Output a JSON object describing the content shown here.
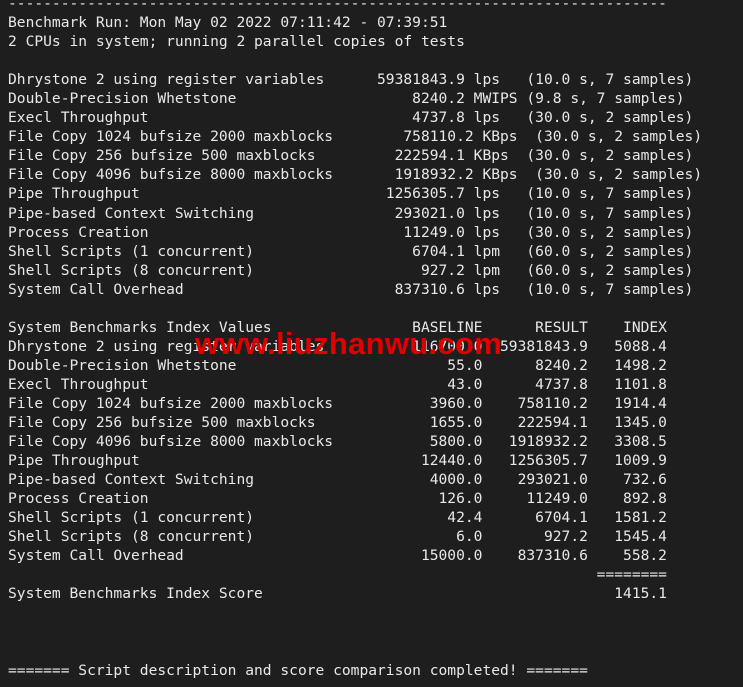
{
  "separator_top": "---------------------------------------------------------------------------",
  "header": {
    "run_line": "Benchmark Run: Mon May 02 2022 07:11:42 - 07:39:51",
    "cpu_line": "2 CPUs in system; running 2 parallel copies of tests"
  },
  "results": [
    {
      "name": "Dhrystone 2 using register variables",
      "value": "59381843.9",
      "unit": "lps",
      "info": "(10.0 s, 7 samples)"
    },
    {
      "name": "Double-Precision Whetstone",
      "value": "8240.2",
      "unit": "MWIPS",
      "info": "(9.8 s, 7 samples)"
    },
    {
      "name": "Execl Throughput",
      "value": "4737.8",
      "unit": "lps",
      "info": "(30.0 s, 2 samples)"
    },
    {
      "name": "File Copy 1024 bufsize 2000 maxblocks",
      "value": "758110.2",
      "unit": "KBps",
      "info": "(30.0 s, 2 samples)"
    },
    {
      "name": "File Copy 256 bufsize 500 maxblocks",
      "value": "222594.1",
      "unit": "KBps",
      "info": "(30.0 s, 2 samples)"
    },
    {
      "name": "File Copy 4096 bufsize 8000 maxblocks",
      "value": "1918932.2",
      "unit": "KBps",
      "info": "(30.0 s, 2 samples)"
    },
    {
      "name": "Pipe Throughput",
      "value": "1256305.7",
      "unit": "lps",
      "info": "(10.0 s, 7 samples)"
    },
    {
      "name": "Pipe-based Context Switching",
      "value": "293021.0",
      "unit": "lps",
      "info": "(10.0 s, 7 samples)"
    },
    {
      "name": "Process Creation",
      "value": "11249.0",
      "unit": "lps",
      "info": "(30.0 s, 2 samples)"
    },
    {
      "name": "Shell Scripts (1 concurrent)",
      "value": "6704.1",
      "unit": "lpm",
      "info": "(60.0 s, 2 samples)"
    },
    {
      "name": "Shell Scripts (8 concurrent)",
      "value": "927.2",
      "unit": "lpm",
      "info": "(60.0 s, 2 samples)"
    },
    {
      "name": "System Call Overhead",
      "value": "837310.6",
      "unit": "lps",
      "info": "(10.0 s, 7 samples)"
    }
  ],
  "index_table": {
    "title": "System Benchmarks Index Values",
    "headers": [
      "BASELINE",
      "RESULT",
      "INDEX"
    ],
    "rows": [
      {
        "name": "Dhrystone 2 using register variables",
        "baseline": "116700.0",
        "result": "59381843.9",
        "index": "5088.4"
      },
      {
        "name": "Double-Precision Whetstone",
        "baseline": "55.0",
        "result": "8240.2",
        "index": "1498.2"
      },
      {
        "name": "Execl Throughput",
        "baseline": "43.0",
        "result": "4737.8",
        "index": "1101.8"
      },
      {
        "name": "File Copy 1024 bufsize 2000 maxblocks",
        "baseline": "3960.0",
        "result": "758110.2",
        "index": "1914.4"
      },
      {
        "name": "File Copy 256 bufsize 500 maxblocks",
        "baseline": "1655.0",
        "result": "222594.1",
        "index": "1345.0"
      },
      {
        "name": "File Copy 4096 bufsize 8000 maxblocks",
        "baseline": "5800.0",
        "result": "1918932.2",
        "index": "3308.5"
      },
      {
        "name": "Pipe Throughput",
        "baseline": "12440.0",
        "result": "1256305.7",
        "index": "1009.9"
      },
      {
        "name": "Pipe-based Context Switching",
        "baseline": "4000.0",
        "result": "293021.0",
        "index": "732.6"
      },
      {
        "name": "Process Creation",
        "baseline": "126.0",
        "result": "11249.0",
        "index": "892.8"
      },
      {
        "name": "Shell Scripts (1 concurrent)",
        "baseline": "42.4",
        "result": "6704.1",
        "index": "1581.2"
      },
      {
        "name": "Shell Scripts (8 concurrent)",
        "baseline": "6.0",
        "result": "927.2",
        "index": "1545.4"
      },
      {
        "name": "System Call Overhead",
        "baseline": "15000.0",
        "result": "837310.6",
        "index": "558.2"
      }
    ],
    "separator": "========",
    "score_label": "System Benchmarks Index Score",
    "score": "1415.1"
  },
  "footer": "======= Script description and score comparison completed! =======",
  "watermark": "www.liuzhanwu.com",
  "colors": {
    "background": "#1e1e1e",
    "text": "#e8e8e8",
    "watermark": "#e00000"
  }
}
